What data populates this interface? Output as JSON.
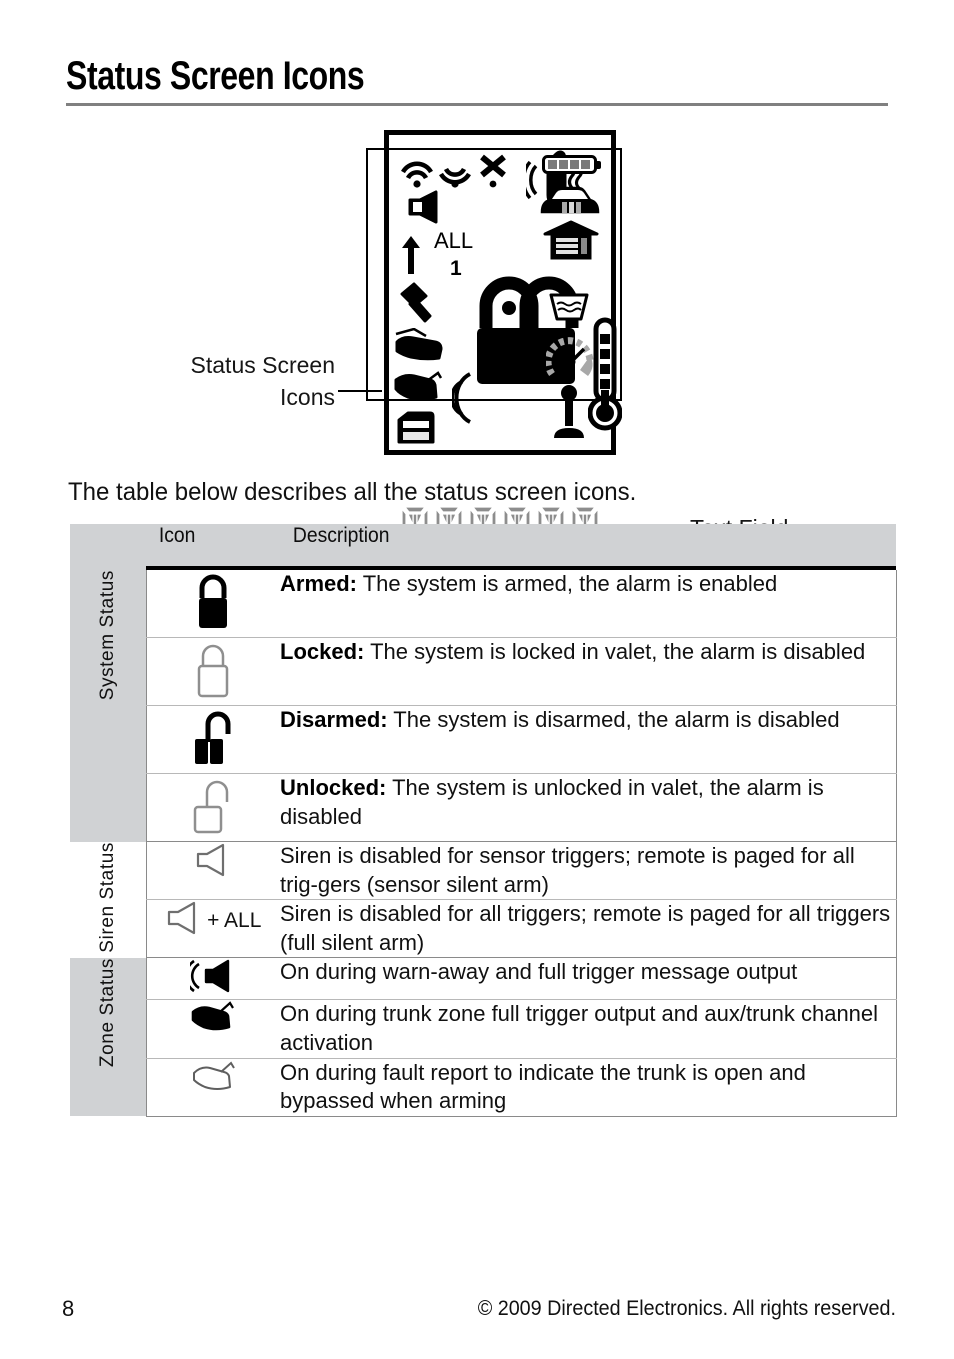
{
  "page": {
    "title": "Status Screen Icons",
    "intro": "The table below describes all the status screen icons.",
    "footer_page_number": "8",
    "footer_copyright": "© 2009 Directed Electronics. All rights reserved."
  },
  "diagram": {
    "callout_left_line1": "Status Screen",
    "callout_left_line2": "Icons",
    "callout_right": "Text Field",
    "lcd_labels": {
      "all": "ALL",
      "one": "1"
    },
    "lcd_icons": [
      "signal-waves-icon",
      "signal-waves-2-icon",
      "x-mark-icon",
      "remote-pager-vibrate-icon",
      "battery-icon",
      "speaker-siren-icon",
      "car-icon",
      "garage-icon",
      "up-arrow-icon",
      "hammer-shock-sensor-icon",
      "hood-open-icon",
      "trunk-open-icon",
      "door-open-icon",
      "padlock-armed-icon",
      "padlock-unlocked-icon",
      "sound-waves-icon",
      "fluid-level-icon",
      "tachometer-icon",
      "gear-shifter-icon",
      "thermometer-icon"
    ],
    "text_field_segments": 6
  },
  "table": {
    "headers": {
      "category": "",
      "icon": "Icon",
      "description": "Description"
    },
    "categories": [
      {
        "label": "System Status",
        "shaded": true,
        "rows": 4
      },
      {
        "label": "Siren Status",
        "shaded": false,
        "rows": 2
      },
      {
        "label": "Zone Status",
        "shaded": true,
        "rows": 3
      }
    ],
    "rows": [
      {
        "icon": "padlock-closed-filled-icon",
        "icon_suffix": "",
        "term": "Armed:",
        "text": " The system is armed, the alarm is enabled"
      },
      {
        "icon": "padlock-closed-outline-icon",
        "icon_suffix": "",
        "term": "Locked:",
        "text": " The system is locked in valet, the alarm is disabled"
      },
      {
        "icon": "padlock-open-filled-icon",
        "icon_suffix": "",
        "term": "Disarmed:",
        "text": " The system is disarmed, the alarm is disabled"
      },
      {
        "icon": "padlock-open-outline-icon",
        "icon_suffix": "",
        "term": "Unlocked:",
        "text": " The system is unlocked in valet, the alarm is disabled"
      },
      {
        "icon": "speaker-outline-icon",
        "icon_suffix": "",
        "term": "",
        "text": "Siren is disabled for sensor triggers; remote is paged for all trig-gers (sensor silent arm)"
      },
      {
        "icon": "speaker-outline-icon",
        "icon_suffix": "+ ALL",
        "term": "",
        "text": "Siren is disabled for all triggers; remote is paged for all triggers (full silent arm)"
      },
      {
        "icon": "speaker-filled-waves-icon",
        "icon_suffix": "",
        "term": "",
        "text": "On during warn-away and full trigger message output"
      },
      {
        "icon": "trunk-filled-icon",
        "icon_suffix": "",
        "term": "",
        "text": "On during trunk zone full trigger output and aux/trunk channel activation"
      },
      {
        "icon": "trunk-outline-icon",
        "icon_suffix": "",
        "term": "",
        "text": "On during fault report to indicate the trunk is open and bypassed when arming"
      }
    ]
  },
  "colors": {
    "shaded_row": "#d0d2d4",
    "rule": "#808080",
    "text": "#111111",
    "segment_gray": "#8d8d8d"
  }
}
